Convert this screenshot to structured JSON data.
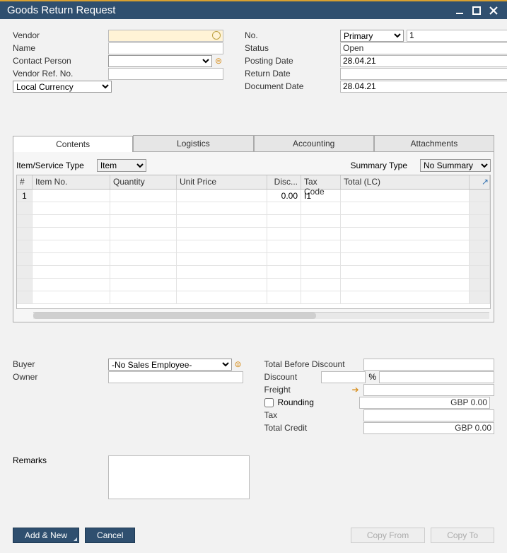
{
  "window": {
    "title": "Goods Return Request"
  },
  "header": {
    "left": {
      "vendor": {
        "label": "Vendor",
        "value": ""
      },
      "name": {
        "label": "Name",
        "value": ""
      },
      "contact": {
        "label": "Contact Person",
        "value": ""
      },
      "vendorRef": {
        "label": "Vendor Ref. No.",
        "value": ""
      },
      "currency": {
        "label": "Local Currency"
      }
    },
    "right": {
      "noLabel": "No.",
      "noSeries": "Primary",
      "noValue": "1",
      "status": {
        "label": "Status",
        "value": "Open"
      },
      "postingDate": {
        "label": "Posting Date",
        "value": "28.04.21"
      },
      "returnDate": {
        "label": "Return Date",
        "value": ""
      },
      "docDate": {
        "label": "Document Date",
        "value": "28.04.21"
      }
    }
  },
  "tabs": {
    "contents": "Contents",
    "logistics": "Logistics",
    "accounting": "Accounting",
    "attachments": "Attachments"
  },
  "contents": {
    "itemTypeLabel": "Item/Service Type",
    "itemType": "Item",
    "summaryTypeLabel": "Summary Type",
    "summaryType": "No Summary",
    "columns": {
      "num": "#",
      "item": "Item No.",
      "qty": "Quantity",
      "price": "Unit Price",
      "disc": "Disc...",
      "tax": "Tax Code",
      "total": "Total (LC)"
    },
    "rows": [
      {
        "num": "1",
        "item": "",
        "qty": "",
        "price": "",
        "disc": "0.00",
        "tax": "I1",
        "total": ""
      }
    ]
  },
  "footer": {
    "buyerLabel": "Buyer",
    "buyer": "-No Sales Employee-",
    "ownerLabel": "Owner",
    "owner": "",
    "totalBeforeLabel": "Total Before Discount",
    "totalBefore": "",
    "discountLabel": "Discount",
    "discountPct": "",
    "pctSign": "%",
    "discountVal": "",
    "freightLabel": "Freight",
    "freight": "",
    "roundingLabel": "Rounding",
    "rounding": "GBP 0.00",
    "taxLabel": "Tax",
    "tax": "",
    "totalCreditLabel": "Total Credit",
    "totalCredit": "GBP 0.00",
    "remarksLabel": "Remarks",
    "remarks": ""
  },
  "actions": {
    "addNew": "Add & New",
    "cancel": "Cancel",
    "copyFrom": "Copy From",
    "copyTo": "Copy To"
  }
}
